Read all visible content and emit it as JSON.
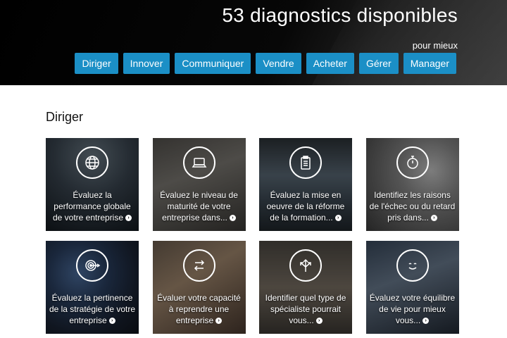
{
  "header": {
    "title": "53 diagnostics disponibles",
    "subtitle": "pour mieux",
    "nav": [
      "Diriger",
      "Innover",
      "Communiquer",
      "Vendre",
      "Acheter",
      "Gérer",
      "Manager"
    ]
  },
  "section": {
    "title": "Diriger"
  },
  "cards": [
    {
      "label": "Évaluez la performance globale de votre entreprise",
      "icon": "globe-icon"
    },
    {
      "label": "Évaluez le niveau de maturité de votre entreprise dans...",
      "icon": "laptop-icon"
    },
    {
      "label": "Évaluez la mise en oeuvre de la réforme de la formation...",
      "icon": "clipboard-icon"
    },
    {
      "label": "Identifiez les raisons de l'échec ou du retard pris dans...",
      "icon": "stopwatch-icon"
    },
    {
      "label": "Évaluez la pertinence de la stratégie de votre entreprise",
      "icon": "target-icon"
    },
    {
      "label": "Évaluer votre capacité à reprendre une entreprise",
      "icon": "exchange-arrows-icon"
    },
    {
      "label": "Identifier quel type de spécialiste pourrait vous...",
      "icon": "split-arrows-icon"
    },
    {
      "label": "Évaluez votre équilibre de vie pour mieux vous...",
      "icon": "smile-icon"
    }
  ],
  "colors": {
    "nav_button": "#1b8fc6",
    "header_bg": "#000000"
  }
}
